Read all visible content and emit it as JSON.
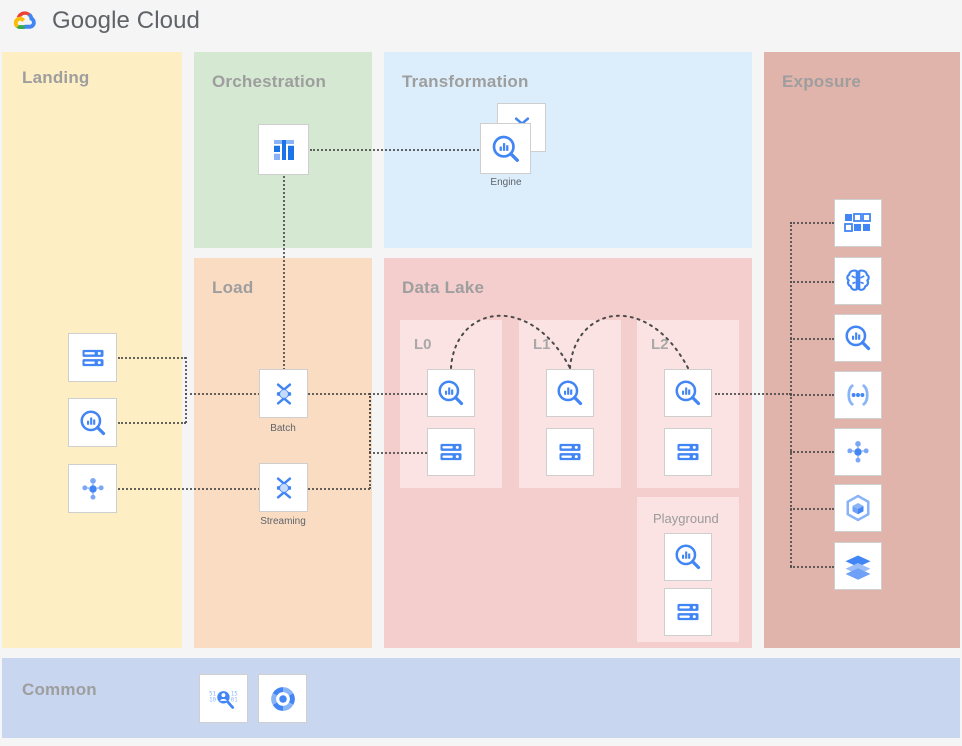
{
  "brand": {
    "name": "Google Cloud",
    "logo_icon": "google-cloud-logo"
  },
  "colors": {
    "background": "#f5f5f5",
    "landing": "#fdeec4",
    "orchestration": "#d4e8d2",
    "transformation": "#dceefb",
    "load": "#fadcc3",
    "data_lake": "#f4cdcd",
    "data_lake_sub": "#fbe3e3",
    "exposure": "#e0b3ab",
    "common": "#c9d6f0",
    "title_text": "#9e9e9e",
    "connector": "#4a4a4a",
    "icon_blue": "#4285f4",
    "icon_blue_light": "#a8c7fa"
  },
  "panels": {
    "landing": {
      "title": "Landing"
    },
    "orchestration": {
      "title": "Orchestration"
    },
    "transformation": {
      "title": "Transformation"
    },
    "load": {
      "title": "Load"
    },
    "data_lake": {
      "title": "Data Lake"
    },
    "exposure": {
      "title": "Exposure"
    },
    "common": {
      "title": "Common"
    }
  },
  "landing": {
    "nodes": [
      {
        "icon": "cloud-storage-icon",
        "label": ""
      },
      {
        "icon": "bigquery-icon",
        "label": ""
      },
      {
        "icon": "pubsub-icon",
        "label": ""
      }
    ]
  },
  "orchestration": {
    "nodes": [
      {
        "icon": "cloud-composer-icon",
        "label": ""
      }
    ]
  },
  "transformation": {
    "nodes": [
      {
        "icon": "dataflow-icon",
        "back_icon": "dataflow-icon",
        "front_icon": "bigquery-icon",
        "label": "Engine"
      }
    ]
  },
  "load": {
    "nodes": [
      {
        "icon": "dataflow-icon",
        "label": "Batch"
      },
      {
        "icon": "dataflow-icon",
        "label": "Streaming"
      }
    ]
  },
  "data_lake": {
    "layers": [
      {
        "title": "L0",
        "nodes": [
          {
            "icon": "bigquery-icon"
          },
          {
            "icon": "cloud-storage-icon"
          }
        ]
      },
      {
        "title": "L1",
        "nodes": [
          {
            "icon": "bigquery-icon"
          },
          {
            "icon": "cloud-storage-icon"
          }
        ]
      },
      {
        "title": "L2",
        "nodes": [
          {
            "icon": "bigquery-icon"
          },
          {
            "icon": "cloud-storage-icon"
          }
        ]
      }
    ],
    "playground": {
      "title": "Playground",
      "nodes": [
        {
          "icon": "bigquery-icon"
        },
        {
          "icon": "cloud-storage-icon"
        }
      ]
    }
  },
  "exposure": {
    "nodes": [
      {
        "icon": "looker-icon"
      },
      {
        "icon": "vertex-ai-icon"
      },
      {
        "icon": "bigquery-icon"
      },
      {
        "icon": "api-gateway-icon"
      },
      {
        "icon": "pubsub-icon"
      },
      {
        "icon": "artifact-registry-icon"
      },
      {
        "icon": "dataproc-icon"
      }
    ]
  },
  "common": {
    "nodes": [
      {
        "icon": "data-loss-prevention-icon"
      },
      {
        "icon": "data-catalog-icon"
      }
    ]
  }
}
